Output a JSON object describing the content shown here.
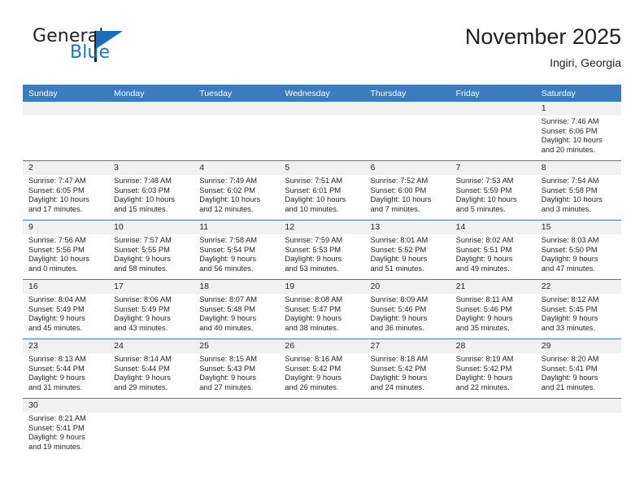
{
  "brand": {
    "name_primary": "General",
    "name_secondary": "Blue"
  },
  "header": {
    "title": "November 2025",
    "location": "Ingiri, Georgia"
  },
  "colors": {
    "header_blue": "#3a7cbf",
    "brand_blue": "#1b76bc",
    "date_band": "#f1f1f1",
    "text": "#231f20"
  },
  "weekdays": [
    "Sunday",
    "Monday",
    "Tuesday",
    "Wednesday",
    "Thursday",
    "Friday",
    "Saturday"
  ],
  "labels": {
    "sunrise_prefix": "Sunrise: ",
    "sunset_prefix": "Sunset: ",
    "daylight_prefix": "Daylight: "
  },
  "weeks": [
    [
      {
        "date": "",
        "empty": true
      },
      {
        "date": "",
        "empty": true
      },
      {
        "date": "",
        "empty": true
      },
      {
        "date": "",
        "empty": true
      },
      {
        "date": "",
        "empty": true
      },
      {
        "date": "",
        "empty": true
      },
      {
        "date": "1",
        "sunrise": "Sunrise: 7:46 AM",
        "sunset": "Sunset: 6:06 PM",
        "daylight1": "Daylight: 10 hours",
        "daylight2": "and 20 minutes."
      }
    ],
    [
      {
        "date": "2",
        "sunrise": "Sunrise: 7:47 AM",
        "sunset": "Sunset: 6:05 PM",
        "daylight1": "Daylight: 10 hours",
        "daylight2": "and 17 minutes."
      },
      {
        "date": "3",
        "sunrise": "Sunrise: 7:48 AM",
        "sunset": "Sunset: 6:03 PM",
        "daylight1": "Daylight: 10 hours",
        "daylight2": "and 15 minutes."
      },
      {
        "date": "4",
        "sunrise": "Sunrise: 7:49 AM",
        "sunset": "Sunset: 6:02 PM",
        "daylight1": "Daylight: 10 hours",
        "daylight2": "and 12 minutes."
      },
      {
        "date": "5",
        "sunrise": "Sunrise: 7:51 AM",
        "sunset": "Sunset: 6:01 PM",
        "daylight1": "Daylight: 10 hours",
        "daylight2": "and 10 minutes."
      },
      {
        "date": "6",
        "sunrise": "Sunrise: 7:52 AM",
        "sunset": "Sunset: 6:00 PM",
        "daylight1": "Daylight: 10 hours",
        "daylight2": "and 7 minutes."
      },
      {
        "date": "7",
        "sunrise": "Sunrise: 7:53 AM",
        "sunset": "Sunset: 5:59 PM",
        "daylight1": "Daylight: 10 hours",
        "daylight2": "and 5 minutes."
      },
      {
        "date": "8",
        "sunrise": "Sunrise: 7:54 AM",
        "sunset": "Sunset: 5:58 PM",
        "daylight1": "Daylight: 10 hours",
        "daylight2": "and 3 minutes."
      }
    ],
    [
      {
        "date": "9",
        "sunrise": "Sunrise: 7:56 AM",
        "sunset": "Sunset: 5:56 PM",
        "daylight1": "Daylight: 10 hours",
        "daylight2": "and 0 minutes."
      },
      {
        "date": "10",
        "sunrise": "Sunrise: 7:57 AM",
        "sunset": "Sunset: 5:55 PM",
        "daylight1": "Daylight: 9 hours",
        "daylight2": "and 58 minutes."
      },
      {
        "date": "11",
        "sunrise": "Sunrise: 7:58 AM",
        "sunset": "Sunset: 5:54 PM",
        "daylight1": "Daylight: 9 hours",
        "daylight2": "and 56 minutes."
      },
      {
        "date": "12",
        "sunrise": "Sunrise: 7:59 AM",
        "sunset": "Sunset: 5:53 PM",
        "daylight1": "Daylight: 9 hours",
        "daylight2": "and 53 minutes."
      },
      {
        "date": "13",
        "sunrise": "Sunrise: 8:01 AM",
        "sunset": "Sunset: 5:52 PM",
        "daylight1": "Daylight: 9 hours",
        "daylight2": "and 51 minutes."
      },
      {
        "date": "14",
        "sunrise": "Sunrise: 8:02 AM",
        "sunset": "Sunset: 5:51 PM",
        "daylight1": "Daylight: 9 hours",
        "daylight2": "and 49 minutes."
      },
      {
        "date": "15",
        "sunrise": "Sunrise: 8:03 AM",
        "sunset": "Sunset: 5:50 PM",
        "daylight1": "Daylight: 9 hours",
        "daylight2": "and 47 minutes."
      }
    ],
    [
      {
        "date": "16",
        "sunrise": "Sunrise: 8:04 AM",
        "sunset": "Sunset: 5:49 PM",
        "daylight1": "Daylight: 9 hours",
        "daylight2": "and 45 minutes."
      },
      {
        "date": "17",
        "sunrise": "Sunrise: 8:06 AM",
        "sunset": "Sunset: 5:49 PM",
        "daylight1": "Daylight: 9 hours",
        "daylight2": "and 43 minutes."
      },
      {
        "date": "18",
        "sunrise": "Sunrise: 8:07 AM",
        "sunset": "Sunset: 5:48 PM",
        "daylight1": "Daylight: 9 hours",
        "daylight2": "and 40 minutes."
      },
      {
        "date": "19",
        "sunrise": "Sunrise: 8:08 AM",
        "sunset": "Sunset: 5:47 PM",
        "daylight1": "Daylight: 9 hours",
        "daylight2": "and 38 minutes."
      },
      {
        "date": "20",
        "sunrise": "Sunrise: 8:09 AM",
        "sunset": "Sunset: 5:46 PM",
        "daylight1": "Daylight: 9 hours",
        "daylight2": "and 36 minutes."
      },
      {
        "date": "21",
        "sunrise": "Sunrise: 8:11 AM",
        "sunset": "Sunset: 5:46 PM",
        "daylight1": "Daylight: 9 hours",
        "daylight2": "and 35 minutes."
      },
      {
        "date": "22",
        "sunrise": "Sunrise: 8:12 AM",
        "sunset": "Sunset: 5:45 PM",
        "daylight1": "Daylight: 9 hours",
        "daylight2": "and 33 minutes."
      }
    ],
    [
      {
        "date": "23",
        "sunrise": "Sunrise: 8:13 AM",
        "sunset": "Sunset: 5:44 PM",
        "daylight1": "Daylight: 9 hours",
        "daylight2": "and 31 minutes."
      },
      {
        "date": "24",
        "sunrise": "Sunrise: 8:14 AM",
        "sunset": "Sunset: 5:44 PM",
        "daylight1": "Daylight: 9 hours",
        "daylight2": "and 29 minutes."
      },
      {
        "date": "25",
        "sunrise": "Sunrise: 8:15 AM",
        "sunset": "Sunset: 5:43 PM",
        "daylight1": "Daylight: 9 hours",
        "daylight2": "and 27 minutes."
      },
      {
        "date": "26",
        "sunrise": "Sunrise: 8:16 AM",
        "sunset": "Sunset: 5:42 PM",
        "daylight1": "Daylight: 9 hours",
        "daylight2": "and 26 minutes."
      },
      {
        "date": "27",
        "sunrise": "Sunrise: 8:18 AM",
        "sunset": "Sunset: 5:42 PM",
        "daylight1": "Daylight: 9 hours",
        "daylight2": "and 24 minutes."
      },
      {
        "date": "28",
        "sunrise": "Sunrise: 8:19 AM",
        "sunset": "Sunset: 5:42 PM",
        "daylight1": "Daylight: 9 hours",
        "daylight2": "and 22 minutes."
      },
      {
        "date": "29",
        "sunrise": "Sunrise: 8:20 AM",
        "sunset": "Sunset: 5:41 PM",
        "daylight1": "Daylight: 9 hours",
        "daylight2": "and 21 minutes."
      }
    ],
    [
      {
        "date": "30",
        "sunrise": "Sunrise: 8:21 AM",
        "sunset": "Sunset: 5:41 PM",
        "daylight1": "Daylight: 9 hours",
        "daylight2": "and 19 minutes."
      },
      {
        "date": "",
        "empty": true
      },
      {
        "date": "",
        "empty": true
      },
      {
        "date": "",
        "empty": true
      },
      {
        "date": "",
        "empty": true
      },
      {
        "date": "",
        "empty": true
      },
      {
        "date": "",
        "empty": true
      }
    ]
  ]
}
